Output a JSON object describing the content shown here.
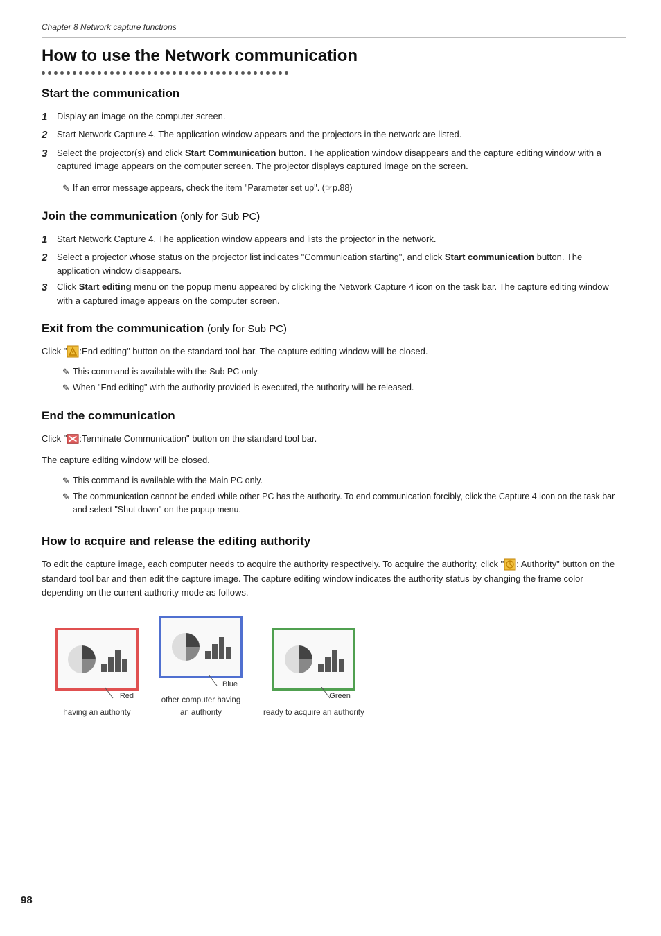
{
  "chapter": "Chapter 8 Network capture functions",
  "page_title": "How to use the Network  communication",
  "sections": [
    {
      "id": "start",
      "title": "Start the communication",
      "subtitle": null,
      "steps": [
        {
          "num": "1",
          "text": "Display an image on the computer screen."
        },
        {
          "num": "2",
          "text": "Start Network Capture 4. The application window appears and the projectors in the network are listed."
        },
        {
          "num": "3",
          "text": "Select the projector(s) and click <strong>Start Communication</strong> button. The application window disappears and the capture editing window with a captured image appears on the computer screen. The projector displays captured image on the screen."
        }
      ],
      "notes": [
        "If an error message appears, check the item \"Parameter set up\". (☞p.88)"
      ]
    },
    {
      "id": "join",
      "title": "Join the communication",
      "subtitle": "(only for Sub PC)",
      "steps": [
        {
          "num": "1",
          "text": "Start Network Capture 4. The application window appears and lists the projector in the network."
        },
        {
          "num": "2",
          "text": "Select a projector whose status on the projector list indicates \"Communication starting\", and click <strong>Start communication</strong> button. The application window disappears."
        },
        {
          "num": "3",
          "text": "Click <strong>Start editing</strong> menu on the popup menu appeared by clicking the Network Capture 4 icon on the task bar. The capture editing window with a captured image appears on the computer screen."
        }
      ],
      "notes": []
    },
    {
      "id": "exit",
      "title": "Exit from the communication",
      "subtitle": "(only for Sub PC)",
      "steps": [],
      "intro": "Click \" ✱:End editing\" button on the standard tool bar. The capture editing window will be closed.",
      "notes": [
        "This command is available with the Sub PC only.",
        "When \"End editing\" with the authority provided is executed, the authority will be released."
      ]
    },
    {
      "id": "end",
      "title": "End the communication",
      "subtitle": null,
      "steps": [],
      "intro_lines": [
        "Click \" ✱:Terminate Communication\" button on the standard tool bar.",
        "The capture editing window will be closed."
      ],
      "notes": [
        "This command is available with the Main PC only.",
        "The communication cannot be ended while other PC has the authority. To end communication forcibly, click the Capture 4 icon on the task bar and select \"Shut down\" on the popup menu."
      ]
    },
    {
      "id": "authority",
      "title": "How to acquire and release the editing authority",
      "subtitle": null,
      "body": "To edit the capture image, each computer needs to acquire the authority respectively. To acquire the authority, click \" ✱: Authority\" button on the standard tool bar and then edit the capture image. The capture editing window indicates the authority status by changing the frame color depending on the current authority mode as follows."
    }
  ],
  "diagrams": [
    {
      "border_color": "red",
      "label": "having an authority",
      "arrow_label": "Red"
    },
    {
      "border_color": "blue",
      "label": "other computer having\nan authority",
      "arrow_label": "Blue"
    },
    {
      "border_color": "green",
      "label": "ready to acquire an authority",
      "arrow_label": "Green"
    }
  ],
  "page_number": "98"
}
